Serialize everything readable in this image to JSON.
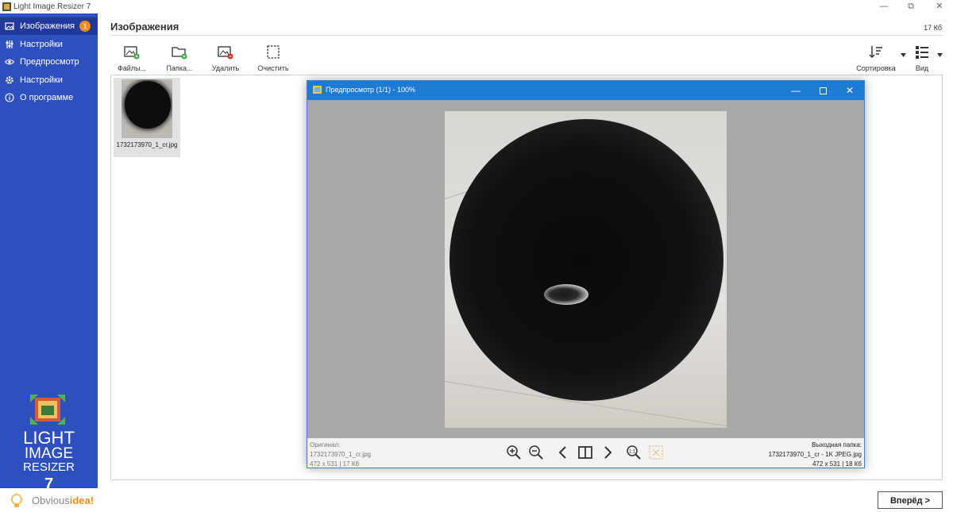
{
  "app": {
    "title": "Light Image Resizer 7"
  },
  "window_controls": {
    "minimize": "—",
    "restore": "⧉",
    "close": "✕"
  },
  "sidebar": {
    "items": [
      {
        "label": "Изображения",
        "icon": "images-icon",
        "badge": "1",
        "active": true
      },
      {
        "label": "Настройки",
        "icon": "sliders-icon"
      },
      {
        "label": "Предпросмотр",
        "icon": "eye-icon"
      },
      {
        "label": "Настройки",
        "icon": "gear-icon"
      },
      {
        "label": "О программе",
        "icon": "info-icon"
      }
    ],
    "logo": {
      "line1": "LIGHT",
      "line2": "IMAGE",
      "line3": "RESIZER",
      "line4": "7"
    }
  },
  "footer": {
    "brand_plain": "Obvious",
    "brand_accent": "idea!",
    "next_button": "Вперёд >"
  },
  "main": {
    "title": "Изображения",
    "total_size": "17 Кб",
    "toolbar": {
      "files": "Файлы...",
      "folder": "Папка...",
      "delete": "Удалить",
      "clear": "Очистить",
      "sort": "Сортировка",
      "view": "Вид"
    },
    "files": [
      {
        "name": "1732173970_1_cr.jpg"
      }
    ]
  },
  "preview": {
    "title": "Предпросмотр (1/1) - 100%",
    "original_label": "Оригинал:",
    "original_name": "1732173970_1_cr.jpg",
    "original_info": "472 x 531  |  17 Кб",
    "output_label": "Выходная папка:",
    "output_name": "1732173970_1_cr - 1K JPEG.jpg",
    "output_info": "472 x 531  |  18 Кб"
  },
  "colors": {
    "sidebar": "#2e4fbe",
    "sidebar_active": "#20399a",
    "badge": "#f28a1c",
    "preview_titlebar": "#1e7bd4",
    "preview_bg": "#a8a8a8"
  }
}
